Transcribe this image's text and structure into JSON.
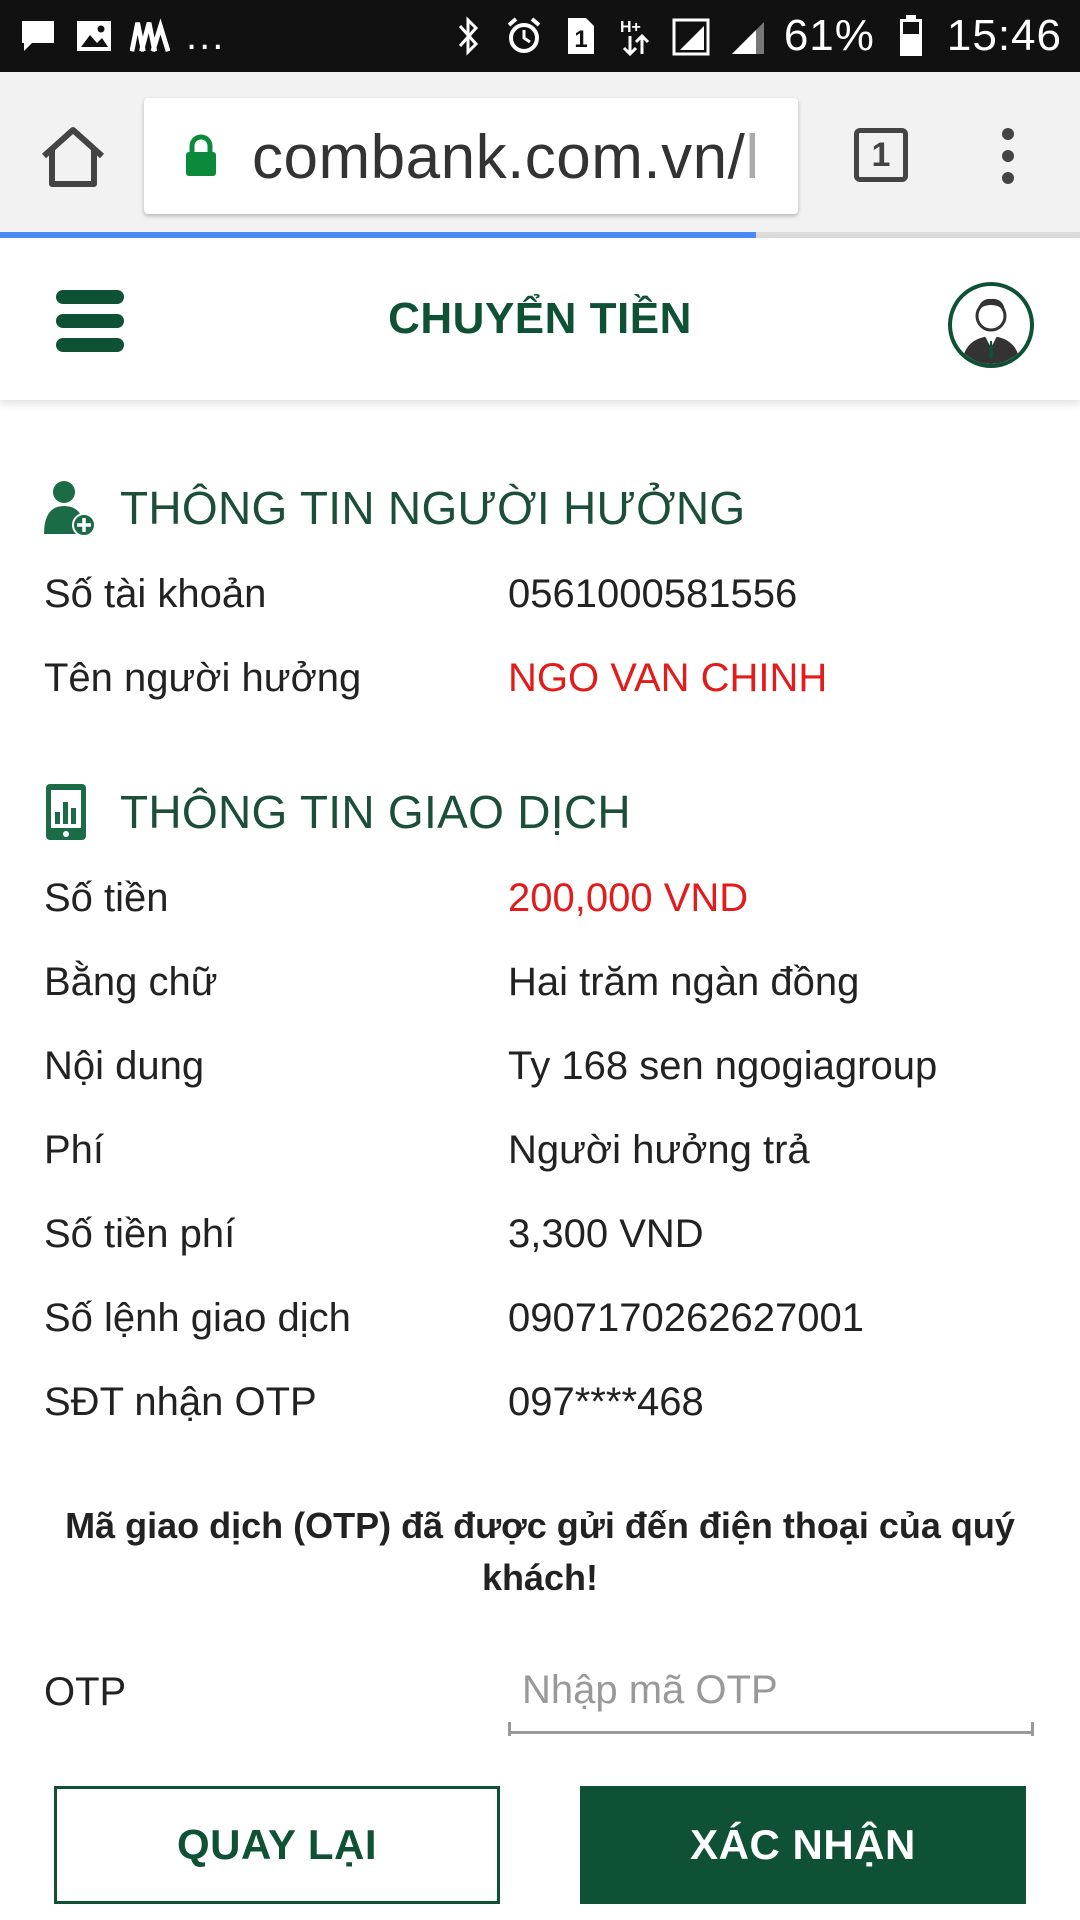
{
  "status_bar": {
    "battery": "61%",
    "time": "15:46",
    "more_dots": "...",
    "sim_badge": "1"
  },
  "browser": {
    "url_text": "combank.com.vn/",
    "url_fade": "l",
    "tab_count": "1",
    "load_progress": 0.7
  },
  "header": {
    "title": "CHUYỂN TIỀN"
  },
  "beneficiary": {
    "section_title": "THÔNG TIN NGƯỜI HƯỞNG",
    "rows": [
      {
        "label": "Số tài khoản",
        "value": "0561000581556"
      },
      {
        "label": "Tên người hưởng",
        "value": "NGO VAN CHINH"
      }
    ]
  },
  "transaction": {
    "section_title": "THÔNG TIN GIAO DỊCH",
    "rows": [
      {
        "label": "Số tiền",
        "value": "200,000 VND"
      },
      {
        "label": "Bằng chữ",
        "value": "Hai trăm ngàn đồng"
      },
      {
        "label": "Nội dung",
        "value": "Ty 168 sen ngogiagroup"
      },
      {
        "label": "Phí",
        "value": "Người hưởng trả"
      },
      {
        "label": "Số tiền phí",
        "value": "3,300 VND"
      },
      {
        "label": "Số lệnh giao dịch",
        "value": "0907170262627001"
      },
      {
        "label": "SĐT nhận OTP",
        "value": "097****468"
      }
    ]
  },
  "notice": "Mã giao dịch (OTP) đã được gửi đến điện thoại của quý khách!",
  "otp": {
    "label": "OTP",
    "placeholder": "Nhập mã OTP",
    "value": ""
  },
  "buttons": {
    "back": "QUAY LẠI",
    "confirm": "XÁC NHẬN"
  },
  "colors": {
    "brand_green": "#0f5135",
    "highlight_red": "#e21b1b",
    "progress_blue": "#4a8af4"
  }
}
